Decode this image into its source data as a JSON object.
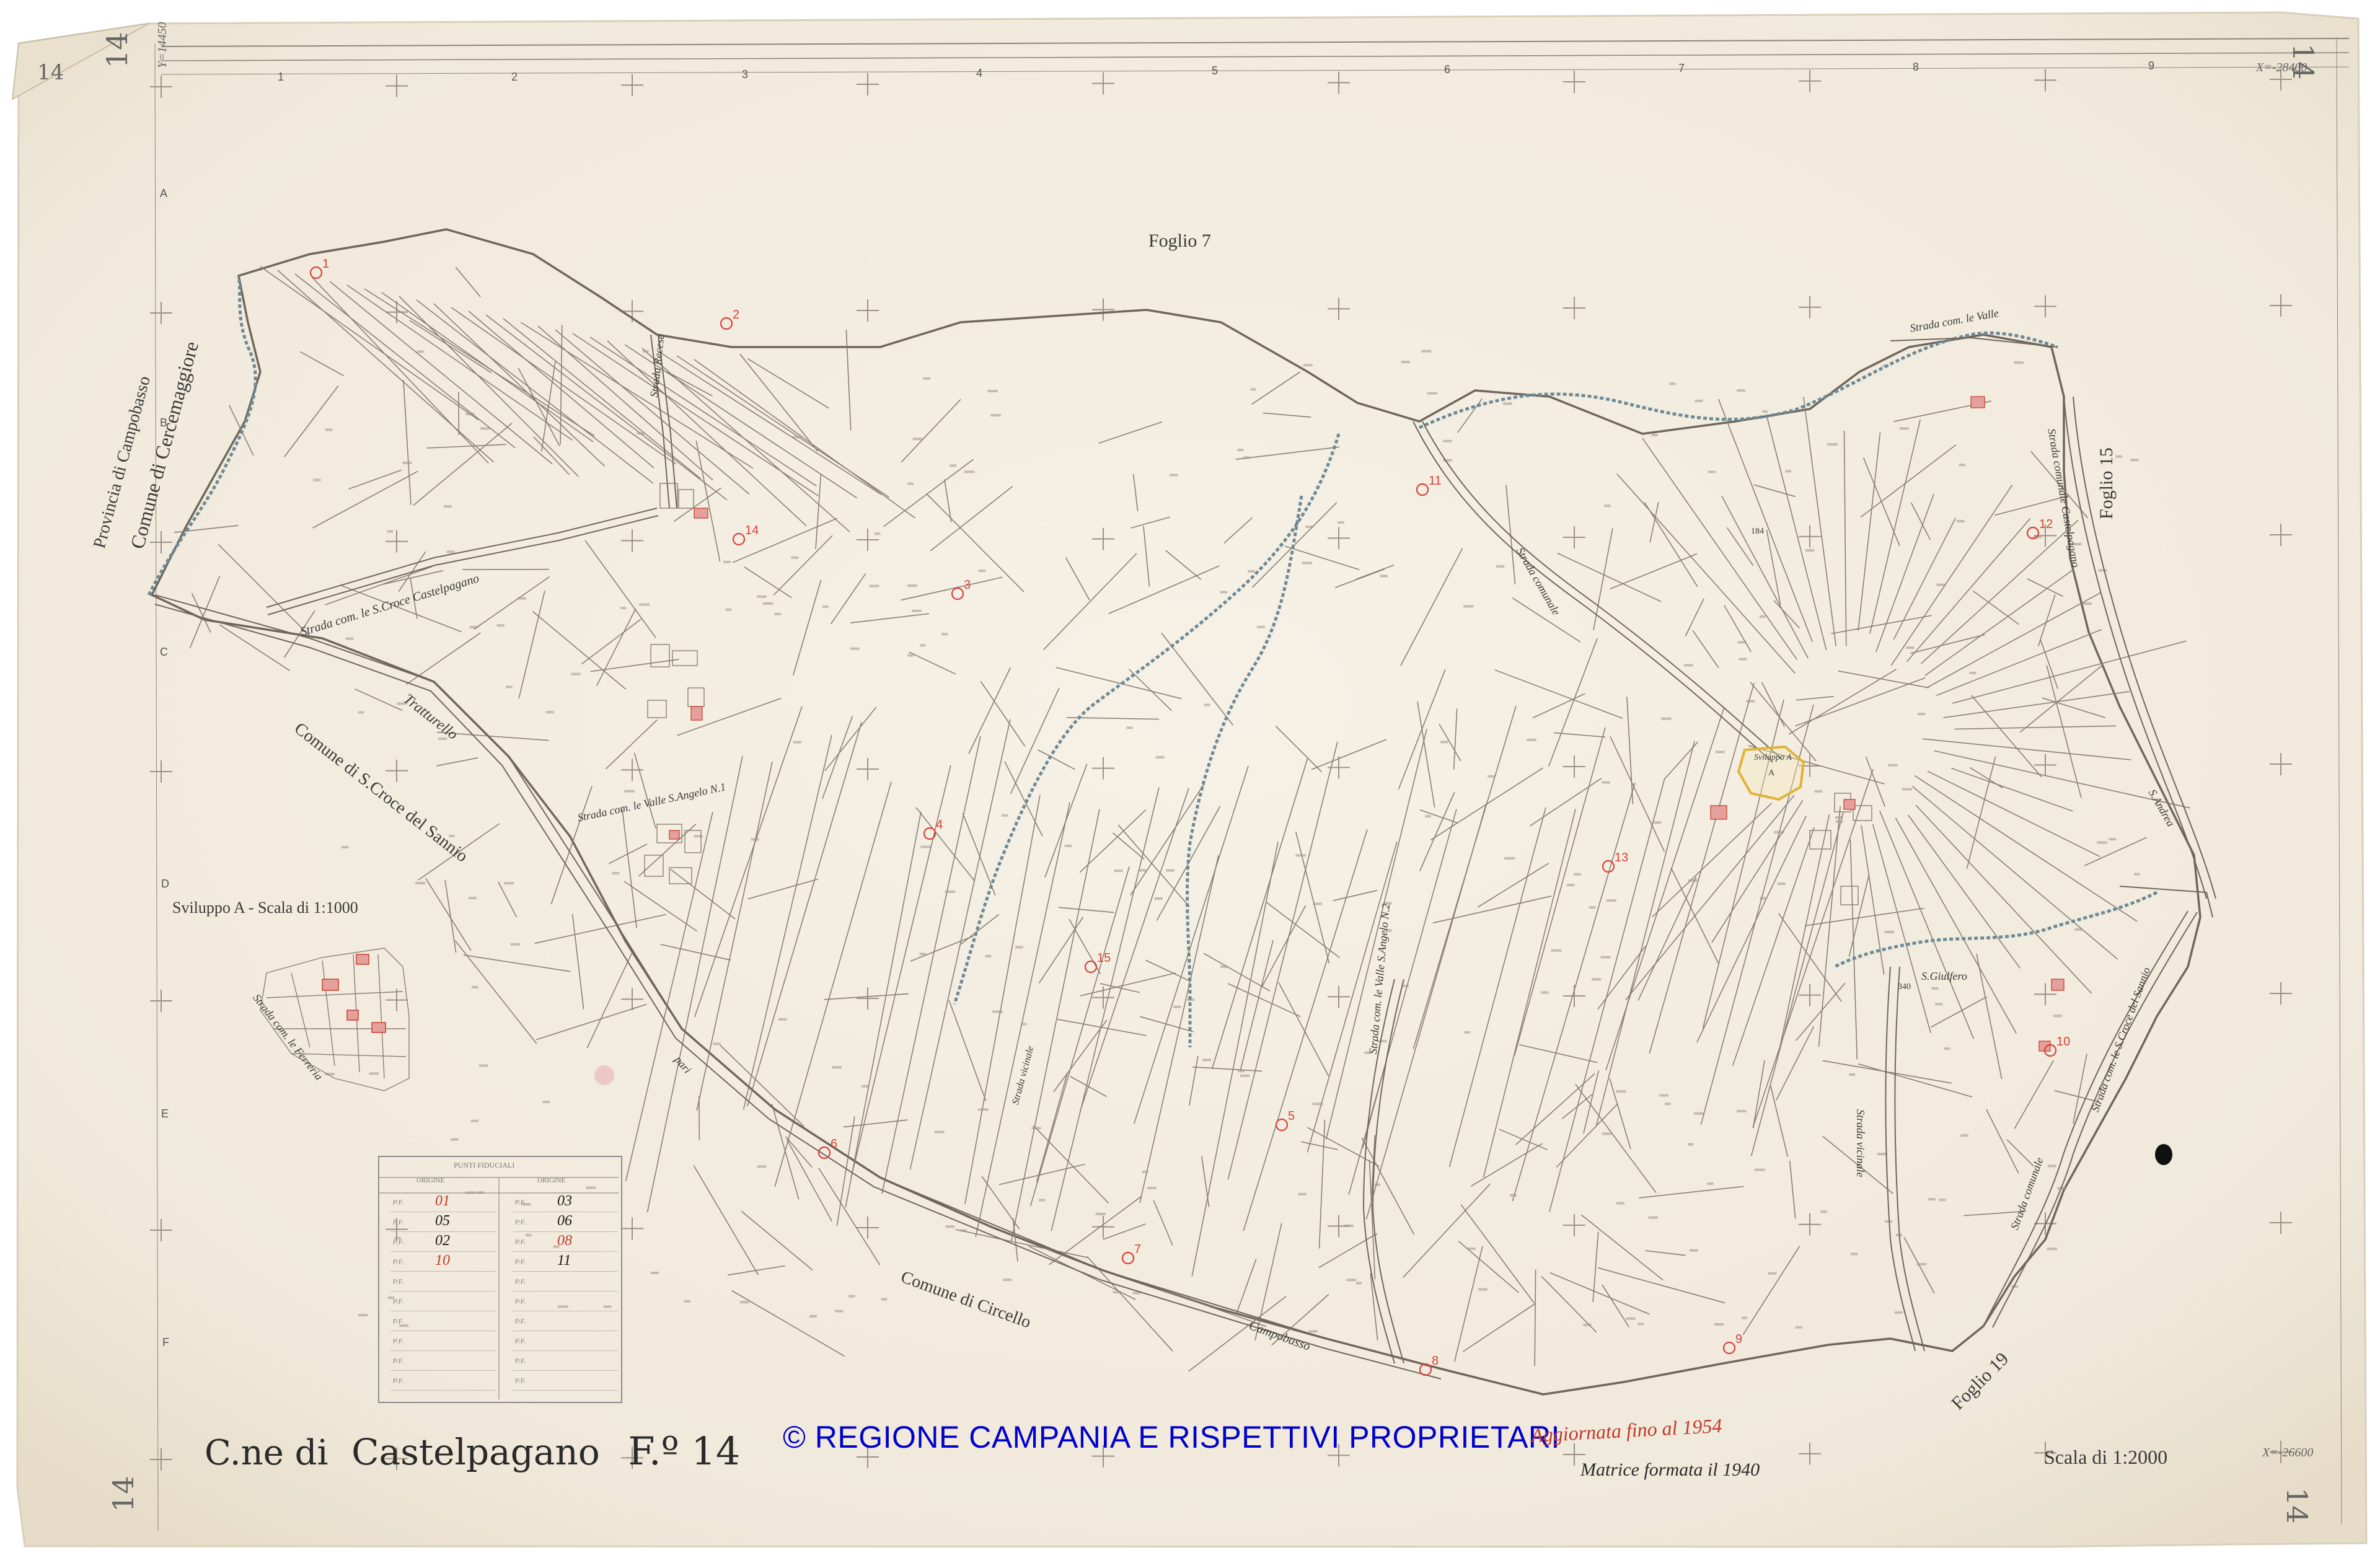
{
  "title": {
    "prefix": "C.ne di",
    "place": "Castelpagano",
    "folio": "F.º 14"
  },
  "copyright": "© REGIONE CAMPANIA E RISPETTIVI PROPRIETARI",
  "corner_marks": [
    "14",
    "14",
    "14",
    "14",
    "14"
  ],
  "grid": {
    "columns": [
      "1",
      "2",
      "3",
      "4",
      "5",
      "6",
      "7",
      "8",
      "9"
    ],
    "rows": [
      "A",
      "B",
      "C",
      "D",
      "E",
      "F"
    ]
  },
  "coordinates": {
    "top_right": "X=-28400",
    "bottom_right": "X=-26600",
    "top_left": "Y=14450"
  },
  "adjacent_sheets": {
    "north": "Foglio 7",
    "east": "Foglio 15",
    "south": "Foglio 19"
  },
  "municipalities": {
    "northwest_province": "Provincia di Campobasso",
    "northwest_comune": "Comune di Cercemaggiore",
    "southwest": "Comune di S.Croce del Sannio",
    "south": "Comune di Circello"
  },
  "roads": {
    "r1": "Strada com. le S.Croce Castelpagano",
    "r2": "Tratturello",
    "r3": "Strada com. le Valle S.Angelo N.1",
    "r4": "Strada com. le Ferreria",
    "r5": "Strada com. le Valle",
    "r6": "Strada comunale",
    "r7": "Strada vicinale",
    "r8": "Strada com. le Valle S.Angelo N.2",
    "r9": "Campobasso",
    "r10": "Strada com. le S.Croce del Sannio",
    "r11": "Strada Recese",
    "r12": "Strada comunale Castelpagano",
    "r13": "Strada vicinale",
    "r14": "Strada comunale",
    "r15": "S.Andrea",
    "r16": "pari",
    "r17": "S.Giulfero"
  },
  "inset": {
    "caption": "Sviluppo A - Scala di 1:1000",
    "map_label": "Sviluppo A",
    "letter": "A"
  },
  "scale": "Scala di 1:2000",
  "update_note": "Aggiornata fino al 1954",
  "matrix_note": "Matrice formata il 1940",
  "parcel_labels": [
    "184",
    "340"
  ],
  "red_markers": [
    "1",
    "2",
    "3",
    "4",
    "5",
    "6",
    "7",
    "8",
    "9",
    "10",
    "11",
    "12",
    "13",
    "14",
    "15"
  ],
  "table": {
    "title": "PUNTI FIDUCIALI",
    "header_left": "ORIGINE",
    "header_right": "ORIGINE",
    "left_rows": [
      {
        "prefix": "P.F.",
        "value": "01",
        "color": "#c0392b"
      },
      {
        "prefix": "P.F.",
        "value": "05",
        "color": "#1a1a1a"
      },
      {
        "prefix": "P.F.",
        "value": "02",
        "color": "#1a1a1a"
      },
      {
        "prefix": "P.F.",
        "value": "10",
        "color": "#c0392b"
      },
      {
        "prefix": "P.F.",
        "value": ""
      },
      {
        "prefix": "P.F.",
        "value": ""
      },
      {
        "prefix": "P.F.",
        "value": ""
      },
      {
        "prefix": "P.F.",
        "value": ""
      },
      {
        "prefix": "P.F.",
        "value": ""
      },
      {
        "prefix": "P.F.",
        "value": ""
      }
    ],
    "right_rows": [
      {
        "prefix": "P.F.",
        "value": "03",
        "color": "#1a1a1a"
      },
      {
        "prefix": "P.F.",
        "value": "06",
        "color": "#1a1a1a"
      },
      {
        "prefix": "P.F.",
        "value": "08",
        "color": "#c0392b"
      },
      {
        "prefix": "P.F.",
        "value": "11",
        "color": "#1a1a1a"
      },
      {
        "prefix": "P.F.",
        "value": ""
      },
      {
        "prefix": "P.F.",
        "value": ""
      },
      {
        "prefix": "P.F.",
        "value": ""
      },
      {
        "prefix": "P.F.",
        "value": ""
      },
      {
        "prefix": "P.F.",
        "value": ""
      },
      {
        "prefix": "P.F.",
        "value": ""
      }
    ]
  },
  "colors": {
    "paper": "#f3ede1",
    "paper_edge": "#e8dfcd",
    "boundary": "#7d7368",
    "road": "#6f665c",
    "stream": "#6e8a96",
    "red_ink": "#d9413a",
    "yellow_ink": "#e0b23a",
    "blue_text": "#0000cc"
  }
}
